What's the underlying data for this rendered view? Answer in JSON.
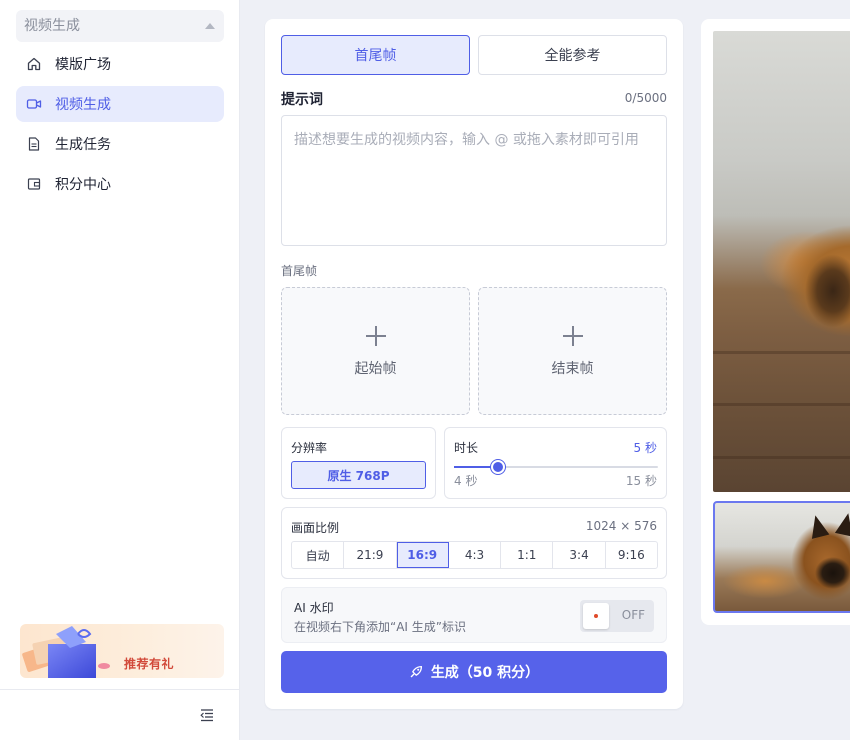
{
  "sidebar": {
    "group_label": "视频生成",
    "items": [
      {
        "label": "模版广场",
        "icon": "home-icon",
        "active": false
      },
      {
        "label": "视频生成",
        "icon": "video-camera-icon",
        "active": true
      },
      {
        "label": "生成任务",
        "icon": "document-icon",
        "active": false
      },
      {
        "label": "积分中心",
        "icon": "wallet-icon",
        "active": false
      }
    ],
    "banner_text": "推荐有礼",
    "collapse_icon": "collapse-menu-icon"
  },
  "form": {
    "mode_tabs": [
      {
        "label": "首尾帧",
        "active": true
      },
      {
        "label": "全能参考",
        "active": false
      }
    ],
    "prompt": {
      "label": "提示词",
      "counter": "0/5000",
      "placeholder": "描述想要生成的视频内容，输入 @ 或拖入素材即可引用"
    },
    "frames": {
      "section_label": "首尾帧",
      "start_label": "起始帧",
      "end_label": "结束帧"
    },
    "resolution": {
      "label": "分辨率",
      "value": "原生 768P"
    },
    "duration": {
      "label": "时长",
      "value_text": "5 秒",
      "min_text": "4 秒",
      "max_text": "15 秒",
      "min": 4,
      "max": 15,
      "value": 5
    },
    "aspect": {
      "label": "画面比例",
      "size_text": "1024 × 576",
      "options": [
        "自动",
        "21:9",
        "16:9",
        "4:3",
        "1:1",
        "3:4",
        "9:16"
      ],
      "selected": "16:9"
    },
    "watermark": {
      "title": "AI 水印",
      "description": "在视频右下角添加“AI 生成”标识",
      "toggle_text": "OFF",
      "enabled": false
    },
    "generate_button": "生成（50 积分）"
  },
  "colors": {
    "accent": "#4f5ee6",
    "accent_light": "#e7ebfd",
    "background": "#eef0f6"
  }
}
